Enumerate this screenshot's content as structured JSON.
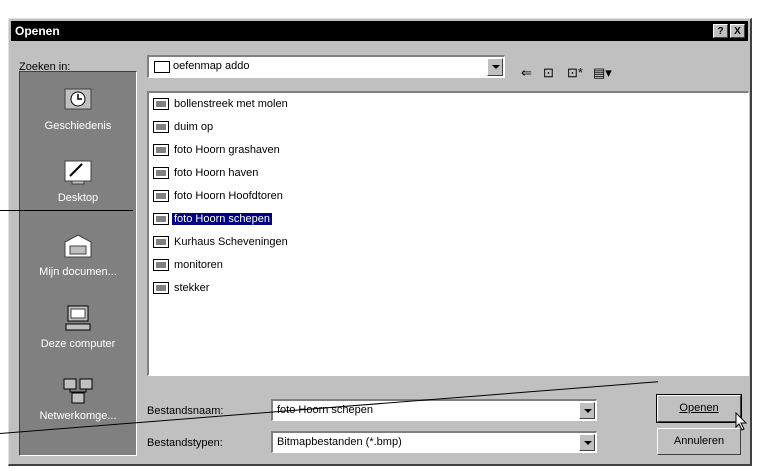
{
  "dialog": {
    "title": "Openen",
    "help_label": "?",
    "close_label": "X"
  },
  "lookin": {
    "label": "Zoeken in:",
    "value": "oefenmap addo"
  },
  "toolbar": {
    "back_label": "⇐",
    "up_label": "⊡",
    "newfolder_label": "⊡*",
    "views_label": "▤▾"
  },
  "places": [
    {
      "label": "Geschiedenis",
      "icon": "history-icon"
    },
    {
      "label": "Desktop",
      "icon": "desktop-icon"
    },
    {
      "label": "Mijn documen...",
      "icon": "my-documents-icon"
    },
    {
      "label": "Deze computer",
      "icon": "my-computer-icon"
    },
    {
      "label": "Netwerkomge...",
      "icon": "network-icon"
    }
  ],
  "files": [
    {
      "name": "bollenstreek met molen"
    },
    {
      "name": "duim op"
    },
    {
      "name": "foto Hoorn grashaven"
    },
    {
      "name": "foto Hoorn haven"
    },
    {
      "name": "foto Hoorn Hoofdtoren"
    },
    {
      "name": "foto Hoorn schepen",
      "selected": true
    },
    {
      "name": "Kurhaus Scheveningen"
    },
    {
      "name": "monitoren"
    },
    {
      "name": "stekker"
    }
  ],
  "filename": {
    "label": "Bestandsnaam:",
    "value": "foto Hoorn schepen"
  },
  "filetype": {
    "label": "Bestandstypen:",
    "value": "Bitmapbestanden (*.bmp)"
  },
  "buttons": {
    "open_label": "Openen",
    "cancel_label": "Annuleren"
  }
}
